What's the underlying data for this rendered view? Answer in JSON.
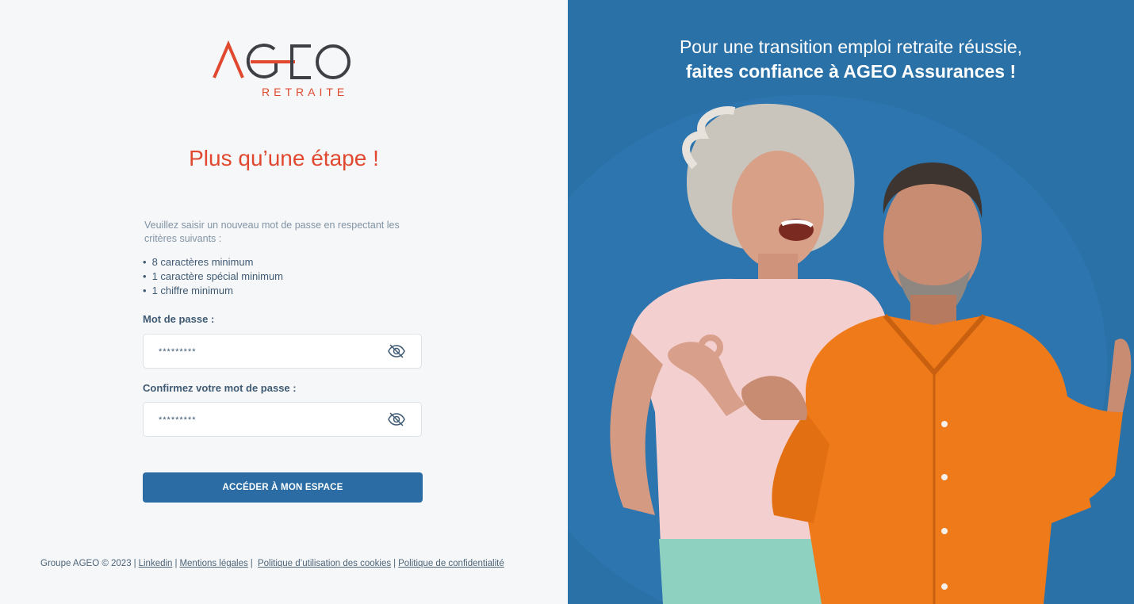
{
  "logo": {
    "word_a": "A",
    "word_rest": "GEO",
    "sub": "RETRAITE"
  },
  "form": {
    "title": "Plus qu’une étape !",
    "intro": "Veuillez saisir un nouveau mot de passe en respectant les critères suivants :",
    "criteria": [
      "8 caractères minimum",
      "1 caractère spécial minimum",
      "1 chiffre minimum"
    ],
    "password_label": "Mot de passe :",
    "password_value": "*********",
    "confirm_label": "Confirmez votre mot de passe :",
    "confirm_value": "*********",
    "submit_label": "ACCÉDER À MON ESPACE"
  },
  "footer": {
    "copyright": "Groupe AGEO © 2023",
    "links": [
      "Linkedin",
      "Mentions légales",
      "Politique d’utilisation des cookies",
      "Politique de confidentialité"
    ]
  },
  "hero": {
    "line1": "Pour une transition emploi retraite réussie,",
    "line2": "faites confiance à AGEO Assurances !"
  },
  "colors": {
    "brand_red": "#e0492f",
    "brand_blue": "#2a6ca3",
    "hero_bg": "#2a71a8"
  },
  "icons": {
    "password_toggle": "eye-slash-icon"
  }
}
